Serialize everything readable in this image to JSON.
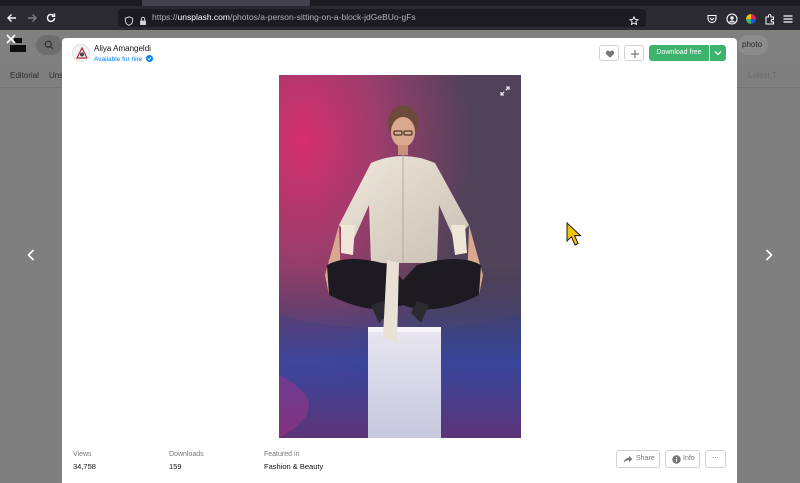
{
  "browser": {
    "url_prefix": "https://",
    "url_host": "unsplash.com",
    "url_path": "/photos/a-person-sitting-on-a-block-jdGeBUo-gFs"
  },
  "background_page": {
    "search_right_text": "photo",
    "tabs": [
      "Editorial",
      "Uns",
      "Latest T"
    ]
  },
  "author": {
    "name": "Aliya Amangeldi",
    "status": "Available for hire"
  },
  "actions": {
    "download_label": "Download free",
    "share_label": "Share",
    "info_label": "Info",
    "more_label": "⋯"
  },
  "stats": [
    {
      "label": "Views",
      "value": "34,758"
    },
    {
      "label": "Downloads",
      "value": "159"
    },
    {
      "label": "Featured in",
      "value": "Fashion & Beauty"
    }
  ],
  "colors": {
    "download_green": "#3cb46e",
    "hire_blue": "#007fff",
    "photo_magenta": "#e8206a",
    "photo_blue": "#2a4fd8"
  },
  "icons": {
    "close": "close-icon",
    "prev": "chevron-left-icon",
    "next": "chevron-right-icon",
    "like": "heart-icon",
    "add": "plus-icon",
    "expand": "expand-icon"
  }
}
